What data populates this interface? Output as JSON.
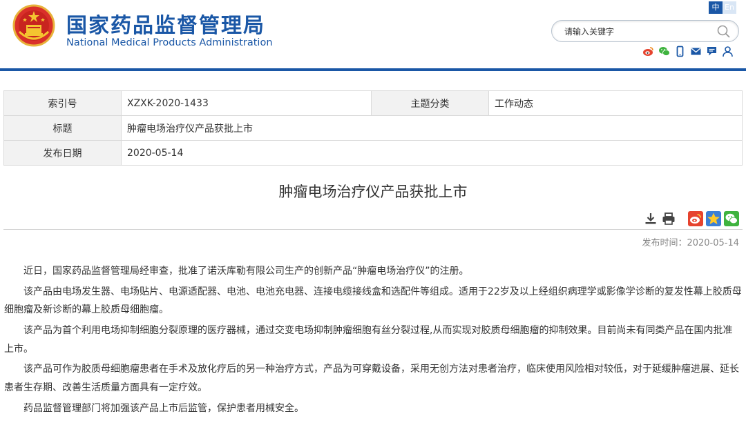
{
  "header": {
    "site_name_cn": "国家药品监督管理局",
    "site_name_en": "National Medical Products Administration",
    "lang_zh": "中",
    "lang_en": "En",
    "search_placeholder": "请输入关键字",
    "tools": [
      "weibo-icon",
      "wechat-icon",
      "mobile-icon",
      "mail-icon",
      "message-icon",
      "user-icon"
    ]
  },
  "info": {
    "index_label": "索引号",
    "index_value": "XZXK-2020-1433",
    "category_label": "主题分类",
    "category_value": "工作动态",
    "title_label": "标题",
    "title_value": "肿瘤电场治疗仪产品获批上市",
    "date_label": "发布日期",
    "date_value": "2020-05-14"
  },
  "article": {
    "title": "肿瘤电场治疗仪产品获批上市",
    "pubdate": "发布时间：2020-05-14",
    "paragraphs": [
      "近日，国家药品监督管理局经审查，批准了诺沃库勒有限公司生产的创新产品“肿瘤电场治疗仪”的注册。",
      "该产品由电场发生器、电场贴片、电源适配器、电池、电池充电器、连接电缆接线盒和选配件等组成。适用于22岁及以上经组织病理学或影像学诊断的复发性幕上胶质母细胞瘤及新诊断的幕上胶质母细胞瘤。",
      "该产品为首个利用电场抑制细胞分裂原理的医疗器械，通过交变电场抑制肿瘤细胞有丝分裂过程,从而实现对胶质母细胞瘤的抑制效果。目前尚未有同类产品在国内批准上市。",
      "该产品可作为胶质母细胞瘤患者在手术及放化疗后的另一种治疗方式，产品为可穿戴设备，采用无创方法对患者治疗，临床使用风险相对较低，对于延缓肿瘤进展、延长患者生存期、改善生活质量方面具有一定疗效。",
      "药品监督管理部门将加强该产品上市后监管，保护患者用械安全。"
    ]
  },
  "colors": {
    "brand_blue": "#1a57a6",
    "weibo_red": "#e6432e",
    "wechat_green": "#3fb33f",
    "star_blue": "#3b7fd6"
  }
}
